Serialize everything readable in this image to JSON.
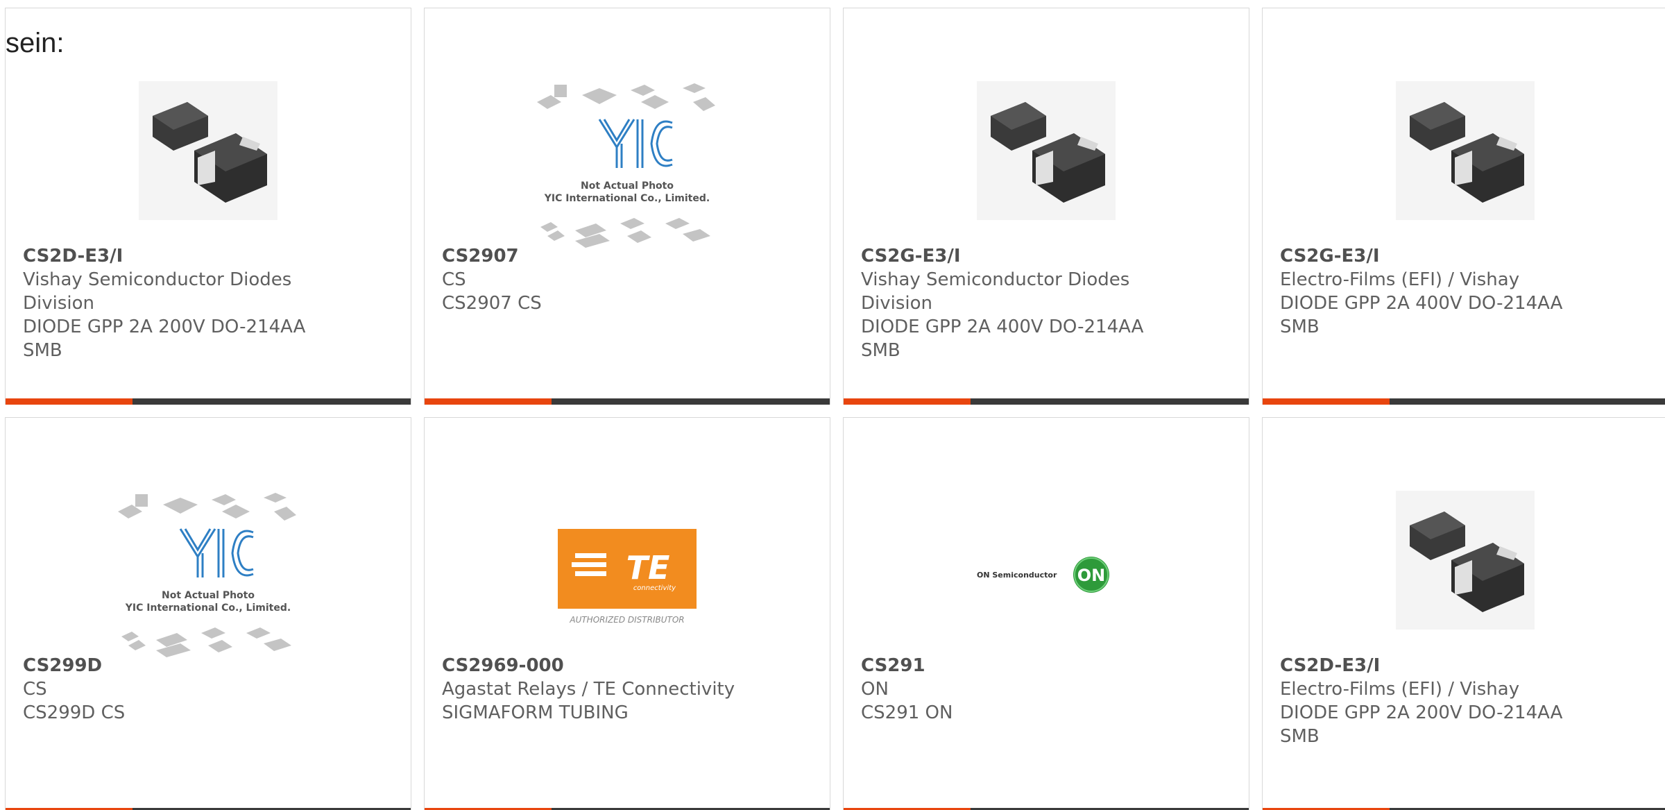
{
  "intro_text": "sein:",
  "brand": {
    "accent": "#e8450e",
    "bar": "#3a3a3a"
  },
  "cards": [
    {
      "part": "CS2D-E3/I",
      "manufacturer": "Vishay Semiconductor Diodes Division",
      "description": "DIODE GPP 2A 200V DO-214AA SMB",
      "image": "smb-diode-photo"
    },
    {
      "part": "CS2907",
      "manufacturer": "CS",
      "description": "CS2907 CS",
      "image": "yic-placeholder",
      "image_text_1": "Not Actual Photo",
      "image_text_2": "YIC International Co., Limited."
    },
    {
      "part": "CS2G-E3/I",
      "manufacturer": "Vishay Semiconductor Diodes Division",
      "description": "DIODE GPP 2A 400V DO-214AA SMB",
      "image": "smb-diode-photo"
    },
    {
      "part": "CS2G-E3/I",
      "manufacturer": "Electro-Films (EFI) / Vishay",
      "description": "DIODE GPP 2A 400V DO-214AA SMB",
      "image": "smb-diode-photo"
    },
    {
      "part": "CS299D",
      "manufacturer": "CS",
      "description": "CS299D CS",
      "image": "yic-placeholder",
      "image_text_1": "Not Actual Photo",
      "image_text_2": "YIC International Co., Limited."
    },
    {
      "part": "CS2969-000",
      "manufacturer": "Agastat Relays / TE Connectivity",
      "description": "SIGMAFORM TUBING",
      "image": "te-logo",
      "image_text_1": "TE",
      "image_text_2": "connectivity",
      "image_text_3": "AUTHORIZED DISTRIBUTOR"
    },
    {
      "part": "CS291",
      "manufacturer": "ON",
      "description": "CS291 ON",
      "image": "onsemi-logo",
      "image_text_1": "ON Semiconductor",
      "image_text_2": "ON"
    },
    {
      "part": "CS2D-E3/I",
      "manufacturer": "Electro-Films (EFI) / Vishay",
      "description": "DIODE GPP 2A 200V DO-214AA SMB",
      "image": "smb-diode-photo"
    }
  ]
}
